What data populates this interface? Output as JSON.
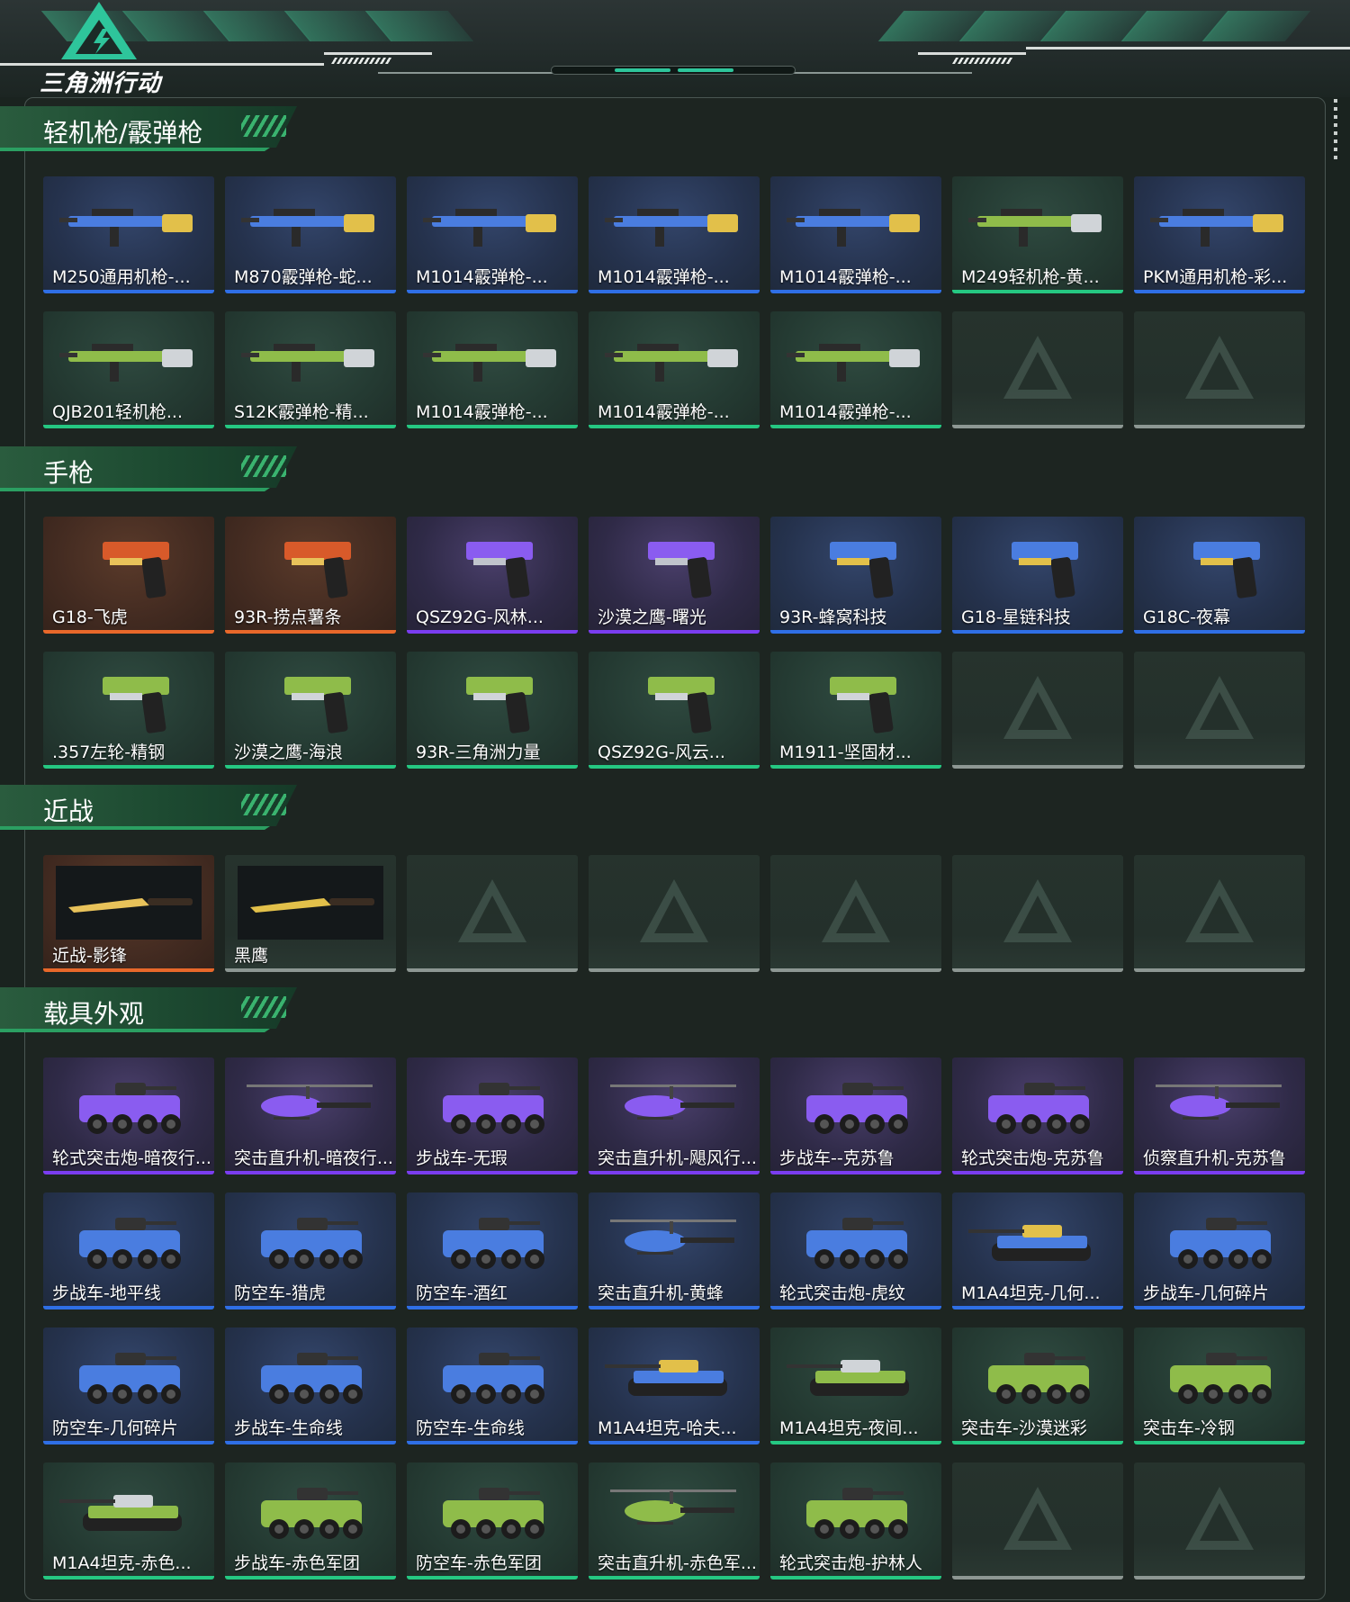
{
  "app": {
    "title": "三角洲行动",
    "accent": "#2ec59b"
  },
  "sections": [
    {
      "title": "轻机枪/霰弹枪",
      "items": [
        {
          "name": "M250通用机枪-...",
          "quality": "blue",
          "kind": "gun"
        },
        {
          "name": "M870霰弹枪-蛇...",
          "quality": "blue",
          "kind": "gun"
        },
        {
          "name": "M1014霰弹枪-...",
          "quality": "blue",
          "kind": "gun"
        },
        {
          "name": "M1014霰弹枪-...",
          "quality": "blue",
          "kind": "gun"
        },
        {
          "name": "M1014霰弹枪-...",
          "quality": "blue",
          "kind": "gun"
        },
        {
          "name": "M249轻机枪-黄...",
          "quality": "green",
          "kind": "gun"
        },
        {
          "name": "PKM通用机枪-彩...",
          "quality": "blue",
          "kind": "gun"
        },
        {
          "name": "QJB201轻机枪...",
          "quality": "green",
          "kind": "gun"
        },
        {
          "name": "S12K霰弹枪-精...",
          "quality": "green",
          "kind": "gun"
        },
        {
          "name": "M1014霰弹枪-...",
          "quality": "green",
          "kind": "gun"
        },
        {
          "name": "M1014霰弹枪-...",
          "quality": "green",
          "kind": "gun"
        },
        {
          "name": "M1014霰弹枪-...",
          "quality": "green",
          "kind": "gun"
        },
        {
          "name": "",
          "quality": "empty"
        },
        {
          "name": "",
          "quality": "empty"
        }
      ]
    },
    {
      "title": "手枪",
      "items": [
        {
          "name": "G18-飞虎",
          "quality": "orange",
          "kind": "pistol"
        },
        {
          "name": "93R-捞点薯条",
          "quality": "orange",
          "kind": "pistol"
        },
        {
          "name": "QSZ92G-风林...",
          "quality": "purple",
          "kind": "pistol"
        },
        {
          "name": "沙漠之鹰-曙光",
          "quality": "purple",
          "kind": "pistol"
        },
        {
          "name": "93R-蜂窝科技",
          "quality": "blue",
          "kind": "pistol"
        },
        {
          "name": "G18-星链科技",
          "quality": "blue",
          "kind": "pistol"
        },
        {
          "name": "G18C-夜幕",
          "quality": "blue",
          "kind": "pistol"
        },
        {
          "name": ".357左轮-精钢",
          "quality": "green",
          "kind": "pistol"
        },
        {
          "name": "沙漠之鹰-海浪",
          "quality": "green",
          "kind": "pistol"
        },
        {
          "name": "93R-三角洲力量",
          "quality": "green",
          "kind": "pistol"
        },
        {
          "name": "QSZ92G-风云...",
          "quality": "green",
          "kind": "pistol"
        },
        {
          "name": "M1911-坚固材...",
          "quality": "green",
          "kind": "pistol"
        },
        {
          "name": "",
          "quality": "empty"
        },
        {
          "name": "",
          "quality": "empty"
        }
      ]
    },
    {
      "title": "近战",
      "items": [
        {
          "name": "近战-影锋",
          "quality": "orange",
          "kind": "knife"
        },
        {
          "name": "黑鹰",
          "quality": "empty-named",
          "kind": "knife"
        },
        {
          "name": "",
          "quality": "empty"
        },
        {
          "name": "",
          "quality": "empty"
        },
        {
          "name": "",
          "quality": "empty"
        },
        {
          "name": "",
          "quality": "empty"
        },
        {
          "name": "",
          "quality": "empty"
        }
      ]
    },
    {
      "title": "载具外观",
      "items": [
        {
          "name": "轮式突击炮-暗夜行...",
          "quality": "purple",
          "kind": "vehicle"
        },
        {
          "name": "突击直升机-暗夜行...",
          "quality": "purple",
          "kind": "heli"
        },
        {
          "name": "步战车-无瑕",
          "quality": "purple",
          "kind": "vehicle"
        },
        {
          "name": "突击直升机-飓风行...",
          "quality": "purple",
          "kind": "heli"
        },
        {
          "name": "步战车--克苏鲁",
          "quality": "purple",
          "kind": "vehicle"
        },
        {
          "name": "轮式突击炮-克苏鲁",
          "quality": "purple",
          "kind": "vehicle"
        },
        {
          "name": "侦察直升机-克苏鲁",
          "quality": "purple",
          "kind": "heli"
        },
        {
          "name": "步战车-地平线",
          "quality": "blue",
          "kind": "vehicle"
        },
        {
          "name": "防空车-猎虎",
          "quality": "blue",
          "kind": "vehicle"
        },
        {
          "name": "防空车-酒红",
          "quality": "blue",
          "kind": "vehicle"
        },
        {
          "name": "突击直升机-黄蜂",
          "quality": "blue",
          "kind": "heli"
        },
        {
          "name": "轮式突击炮-虎纹",
          "quality": "blue",
          "kind": "vehicle"
        },
        {
          "name": "M1A4坦克-几何...",
          "quality": "blue",
          "kind": "tank"
        },
        {
          "name": "步战车-几何碎片",
          "quality": "blue",
          "kind": "vehicle"
        },
        {
          "name": "防空车-几何碎片",
          "quality": "blue",
          "kind": "vehicle"
        },
        {
          "name": "步战车-生命线",
          "quality": "blue",
          "kind": "vehicle"
        },
        {
          "name": "防空车-生命线",
          "quality": "blue",
          "kind": "vehicle"
        },
        {
          "name": "M1A4坦克-哈夫...",
          "quality": "blue",
          "kind": "tank"
        },
        {
          "name": "M1A4坦克-夜间...",
          "quality": "green",
          "kind": "tank"
        },
        {
          "name": "突击车-沙漠迷彩",
          "quality": "green",
          "kind": "vehicle"
        },
        {
          "name": "突击车-冷钢",
          "quality": "green",
          "kind": "vehicle"
        },
        {
          "name": "M1A4坦克-赤色...",
          "quality": "green",
          "kind": "tank"
        },
        {
          "name": "步战车-赤色军团",
          "quality": "green",
          "kind": "vehicle"
        },
        {
          "name": "防空车-赤色军团",
          "quality": "green",
          "kind": "vehicle"
        },
        {
          "name": "突击直升机-赤色军...",
          "quality": "green",
          "kind": "heli"
        },
        {
          "name": "轮式突击炮-护林人",
          "quality": "green",
          "kind": "vehicle"
        },
        {
          "name": "",
          "quality": "empty"
        },
        {
          "name": "",
          "quality": "empty"
        }
      ]
    }
  ]
}
